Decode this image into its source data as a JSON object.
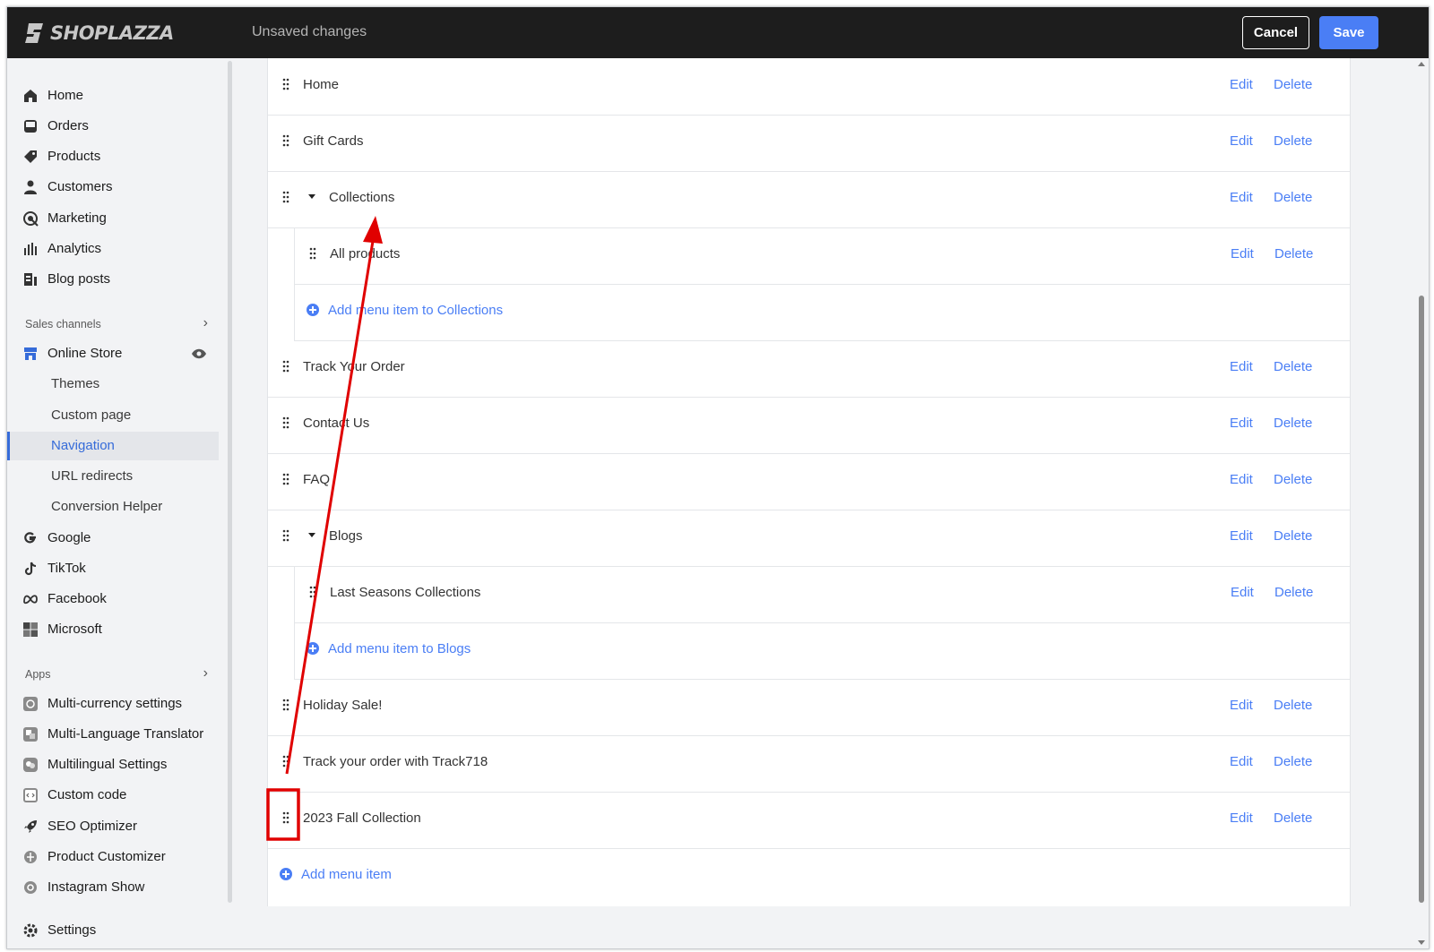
{
  "topbar": {
    "brand": "SHOPLAZZA",
    "status": "Unsaved changes",
    "cancel_label": "Cancel",
    "save_label": "Save"
  },
  "sidebar": {
    "main_items": [
      {
        "label": "Home",
        "icon": "home-icon"
      },
      {
        "label": "Orders",
        "icon": "orders-icon"
      },
      {
        "label": "Products",
        "icon": "tag-icon"
      },
      {
        "label": "Customers",
        "icon": "person-icon"
      },
      {
        "label": "Marketing",
        "icon": "marketing-icon"
      },
      {
        "label": "Analytics",
        "icon": "bar-chart-icon"
      },
      {
        "label": "Blog posts",
        "icon": "blog-icon"
      }
    ],
    "sales_channels_header": "Sales channels",
    "online_store": {
      "label": "Online Store",
      "icon": "store-icon",
      "action_icon": "eye-icon"
    },
    "online_store_subitems": [
      "Themes",
      "Custom page",
      "Navigation",
      "URL redirects",
      "Conversion Helper"
    ],
    "active_subitem": "Navigation",
    "channels": [
      {
        "label": "Google",
        "icon": "google-icon"
      },
      {
        "label": "TikTok",
        "icon": "tiktok-icon"
      },
      {
        "label": "Facebook",
        "icon": "meta-icon"
      },
      {
        "label": "Microsoft",
        "icon": "microsoft-icon"
      }
    ],
    "apps_header": "Apps",
    "apps": [
      {
        "label": "Multi-currency settings",
        "icon": "currency-app-icon"
      },
      {
        "label": "Multi-Language Translator",
        "icon": "translator-app-icon"
      },
      {
        "label": "Multilingual Settings",
        "icon": "multilingual-app-icon"
      },
      {
        "label": "Custom code",
        "icon": "code-app-icon"
      },
      {
        "label": "SEO Optimizer",
        "icon": "rocket-icon"
      },
      {
        "label": "Product Customizer",
        "icon": "customizer-app-icon"
      },
      {
        "label": "Instagram Show",
        "icon": "instagram-app-icon"
      }
    ],
    "settings_label": "Settings"
  },
  "menu": {
    "edit_label": "Edit",
    "delete_label": "Delete",
    "items": {
      "home": "Home",
      "gift_cards": "Gift Cards",
      "collections": "Collections",
      "all_products": "All products",
      "add_to_collections": "Add menu item to Collections",
      "track_order": "Track Your Order",
      "contact": "Contact Us",
      "faq": "FAQ",
      "blogs": "Blogs",
      "last_seasons": "Last Seasons Collections",
      "add_to_blogs": "Add menu item to Blogs",
      "holiday": "Holiday Sale!",
      "track718": "Track your order with Track718",
      "fall_2023": "2023 Fall Collection"
    },
    "add_menu_item": "Add menu item"
  },
  "colors": {
    "accent": "#4a7ef5",
    "topbar": "#1d1d1d",
    "annotation": "#e00000"
  }
}
